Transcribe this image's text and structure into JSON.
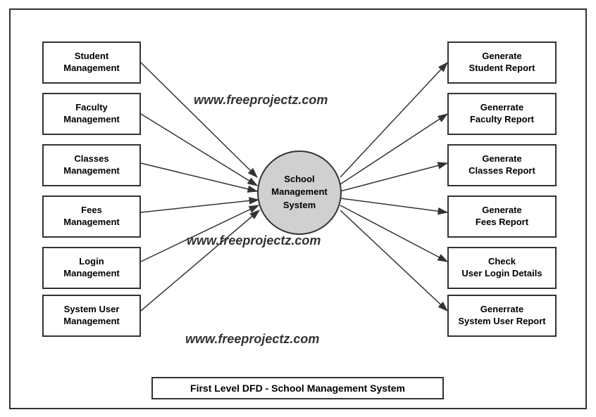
{
  "diagram": {
    "title": "First Level DFD - School Management System",
    "center": {
      "label": "School\nManagement\nSystem"
    },
    "watermarks": [
      "www.freeprojectz.com",
      "www.freeprojectz.com",
      "www.freeprojectz.com"
    ],
    "left_nodes": [
      {
        "id": "student-mgmt",
        "label": "Student\nManagement"
      },
      {
        "id": "faculty-mgmt",
        "label": "Faculty\nManagement"
      },
      {
        "id": "classes-mgmt",
        "label": "Classes\nManagement"
      },
      {
        "id": "fees-mgmt",
        "label": "Fees\nManagement"
      },
      {
        "id": "login-mgmt",
        "label": "Login\nManagement"
      },
      {
        "id": "system-user-mgmt",
        "label": "System User\nManagement"
      }
    ],
    "right_nodes": [
      {
        "id": "gen-student",
        "label": "Generate\nStudent Report"
      },
      {
        "id": "gen-faculty",
        "label": "Generrate\nFaculty Report"
      },
      {
        "id": "gen-classes",
        "label": "Generate\nClasses Report"
      },
      {
        "id": "gen-fees",
        "label": "Generate\nFees Report"
      },
      {
        "id": "check-login",
        "label": "Check\nUser Login Details"
      },
      {
        "id": "gen-system-user",
        "label": "Generrate\nSystem User Report"
      }
    ]
  }
}
